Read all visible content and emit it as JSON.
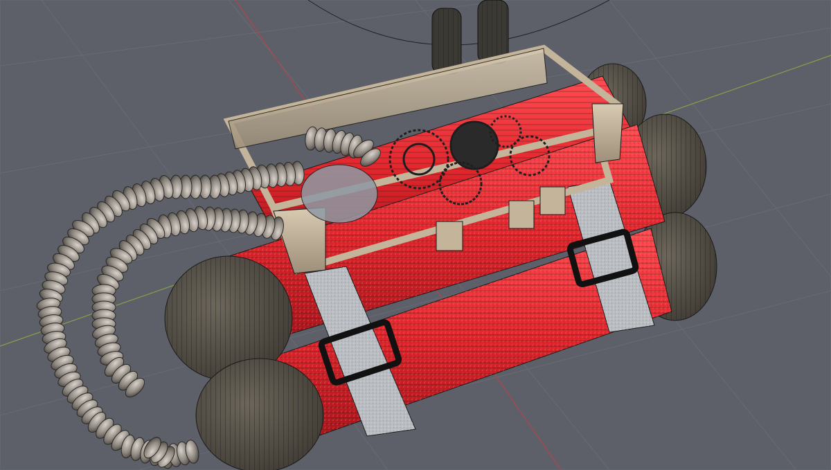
{
  "scene": {
    "background_color": "#5d6068",
    "grid_line_color": "#6a6d75",
    "axis_x_color": "#b0444e",
    "axis_y_color": "#8aa04a",
    "tube_body_color": "#d8252b",
    "tube_highlight_color": "#ff4a4f",
    "cap_color": "#56524a",
    "strap_color": "#b9bcc0",
    "buckle_color": "#111111",
    "frame_color": "#c4b49a",
    "frame_shade_color": "#8e816e",
    "coil_color": "#8d8780",
    "gear_color": "#2a2a2a",
    "vacuum_tube_color": "#3a3934",
    "wireframe_color": "#1a1a1a",
    "objects": [
      "grid-floor",
      "red-cylinder-tubes",
      "cylinder-end-caps",
      "straps-with-buckles",
      "clockwork-frame",
      "vacuum-tubes",
      "gear-mechanism",
      "coiled-cable"
    ]
  }
}
